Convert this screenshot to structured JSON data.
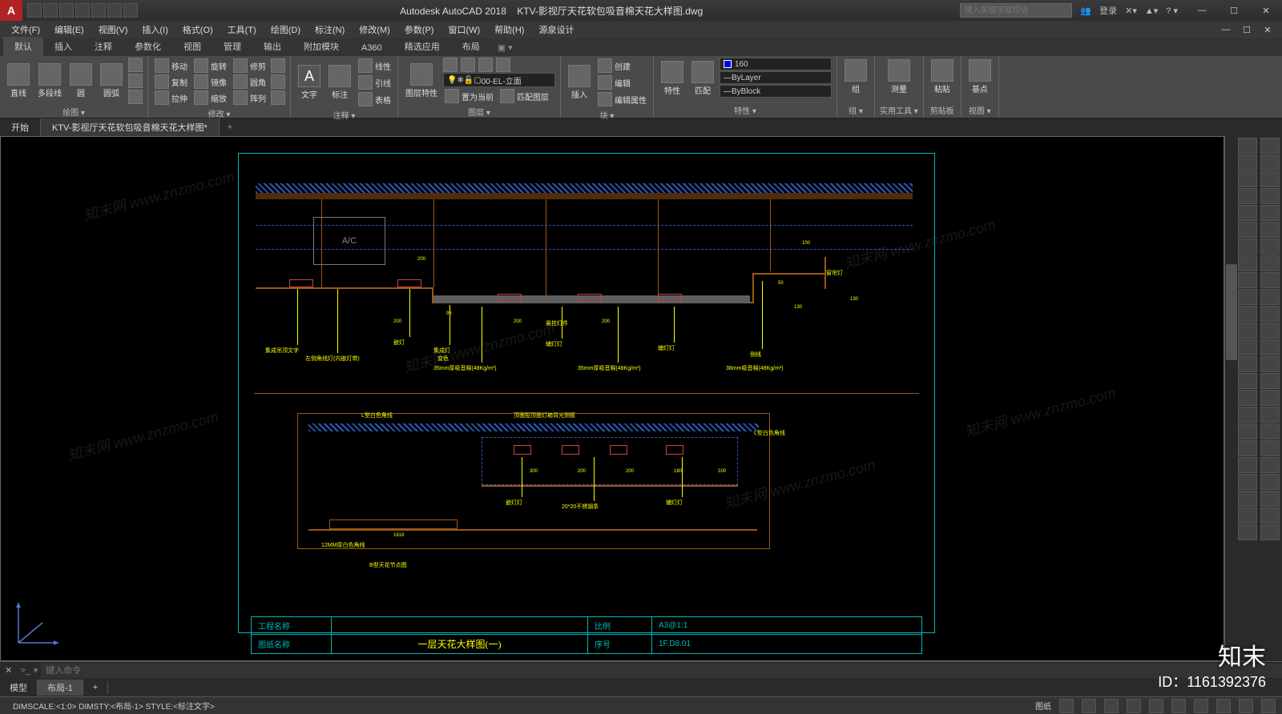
{
  "title": {
    "app": "Autodesk AutoCAD 2018",
    "doc": "KTV-影视厅天花软包吸音棉天花大样图.dwg",
    "search_ph": "键入关键字或短语",
    "login": "登录"
  },
  "menus": [
    "文件(F)",
    "编辑(E)",
    "视图(V)",
    "插入(I)",
    "格式(O)",
    "工具(T)",
    "绘图(D)",
    "标注(N)",
    "修改(M)",
    "参数(P)",
    "窗口(W)",
    "帮助(H)",
    "源泉设计"
  ],
  "ribbon_tabs": [
    "默认",
    "插入",
    "注释",
    "参数化",
    "视图",
    "管理",
    "输出",
    "附加模块",
    "A360",
    "精选应用",
    "布局"
  ],
  "panels": {
    "draw": {
      "title": "绘图 ▾",
      "items": [
        "直线",
        "多段线",
        "圆",
        "圆弧"
      ]
    },
    "modify": {
      "title": "修改 ▾",
      "rows": [
        [
          "移动",
          "旋转",
          "修剪"
        ],
        [
          "复制",
          "镜像",
          "圆角"
        ],
        [
          "拉伸",
          "缩放",
          "阵列"
        ]
      ]
    },
    "annot": {
      "title": "注释 ▾",
      "items": [
        "文字",
        "标注"
      ],
      "sub": [
        "线性",
        "引线",
        "表格"
      ]
    },
    "layer": {
      "title": "图层 ▾",
      "btn": "图层特性",
      "current": "00-EL-立面",
      "items": [
        "置为当前",
        "匹配图层"
      ]
    },
    "block": {
      "title": "块 ▾",
      "btn": "插入",
      "items": [
        "创建",
        "编辑",
        "编辑属性"
      ]
    },
    "prop": {
      "title": "特性 ▾",
      "btn1": "特性",
      "btn2": "匹配",
      "color": "160",
      "line1": "ByLayer",
      "line2": "ByBlock"
    },
    "group": {
      "title": "组 ▾",
      "btn": "组"
    },
    "util": {
      "title": "实用工具 ▾",
      "btn": "测量"
    },
    "clip": {
      "title": "剪贴板",
      "btn": "粘贴"
    },
    "view": {
      "title": "视图 ▾",
      "btn": "基点"
    }
  },
  "file_tabs": {
    "start": "开始",
    "doc": "KTV-影视厅天花软包吸音棉天花大样图*"
  },
  "titleblock": {
    "r1c1": "工程名称",
    "r1c3": "比例",
    "r1c4": "A3@1:1",
    "r2c1": "图纸名称",
    "r2c2": "一层天花大样图(一)",
    "r2c3": "序号",
    "r2c4": "1F.D8.01"
  },
  "annotations": {
    "top": [
      "A/C",
      "集成吊顶文字",
      "左侧角线灯(内嵌灯带)",
      "嵌灯",
      "集成灯",
      "变色",
      "35mm厚吸音棉(48Kg/m³)",
      "辅灯灯",
      "悬挂灯件",
      "35mm厚吸音棉(48Kg/m³)",
      "辅灯灯",
      "侧线",
      "38mm吸音棉(48Kg/m³)",
      "窗帘灯"
    ],
    "dims_top": [
      "200",
      "200",
      "95",
      "200",
      "200",
      "130",
      "50",
      "100",
      "130"
    ],
    "bottom_labels": [
      "L型白色角线",
      "顶面配顶面灯箱背光侧板",
      "L型白色角线",
      "嵌灯灯",
      "20*20不锈钢条",
      "辅灯灯"
    ],
    "bottom_dims": [
      "300",
      "200",
      "200",
      "180",
      "100"
    ],
    "bottom2": [
      "12MM厚白色角线",
      "B型天花节点图",
      "1618"
    ]
  },
  "cmd": {
    "prompt": "键入命令",
    "icon": ">_"
  },
  "layouts": [
    "模型",
    "布局-1"
  ],
  "status": {
    "left": "DIMSCALE:<1:0> DIMSTY:<布局-1> STYLE:<标注文字>",
    "paper": "图纸"
  },
  "watermark": "知末网 www.znzmo.com",
  "brand": "知末",
  "brand_id": "ID：1161392376"
}
